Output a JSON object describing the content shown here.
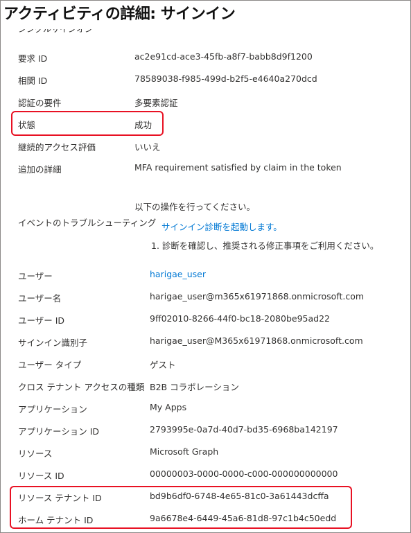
{
  "panel": {
    "title": "アクティビティの詳細: サインイン",
    "cut_row_text": "シングルサインオン"
  },
  "rows_a": [
    {
      "label": "要求 ID",
      "value": "ac2e91cd-ace3-45fb-a8f7-babb8d9f1200"
    },
    {
      "label": "相関 ID",
      "value": "78589038-f985-499d-b2f5-e4640a270dcd"
    },
    {
      "label": "認証の要件",
      "value": "多要素認証"
    },
    {
      "label": "状態",
      "value": "成功"
    },
    {
      "label": "継続的アクセス評価",
      "value": "いいえ"
    },
    {
      "label": "追加の詳細",
      "value": "MFA requirement satisfied by claim in the token"
    }
  ],
  "troubleshoot": {
    "label": "イベントのトラブルシューティング",
    "intro": "以下の操作を行ってください。",
    "link": "サインイン診断を起動します。",
    "step": "1. 診断を確認し、推奨される修正事項をご利用ください。"
  },
  "rows_b": [
    {
      "label": "ユーザー",
      "value": "harigae_user"
    },
    {
      "label": "ユーザー名",
      "value": "harigae_user@m365x61971868.onmicrosoft.com"
    },
    {
      "label": "ユーザー ID",
      "value": "9ff02010-8266-44f0-bc18-2080be95ad22"
    },
    {
      "label": "サインイン識別子",
      "value": "harigae_user@M365x61971868.onmicrosoft.com"
    },
    {
      "label": "ユーザー タイプ",
      "value": "ゲスト"
    },
    {
      "label": "クロス テナント アクセスの種類",
      "value": "B2B コラボレーション"
    },
    {
      "label": "アプリケーション",
      "value": "My Apps"
    },
    {
      "label": "アプリケーション ID",
      "value": "2793995e-0a7d-40d7-bd35-6968ba142197"
    },
    {
      "label": "リソース",
      "value": "Microsoft Graph"
    },
    {
      "label": "リソース ID",
      "value": "00000003-0000-0000-c000-000000000000"
    },
    {
      "label": "リソース テナント ID",
      "value": "bd9b6df0-6748-4e65-81c0-3a61443dcffa"
    },
    {
      "label": "ホーム テナント ID",
      "value": "9a6678e4-6449-45a6-81d8-97c1b4c50edd"
    }
  ],
  "colors": {
    "link": "#0078d4",
    "highlight": "#e81123",
    "text": "#323130"
  }
}
